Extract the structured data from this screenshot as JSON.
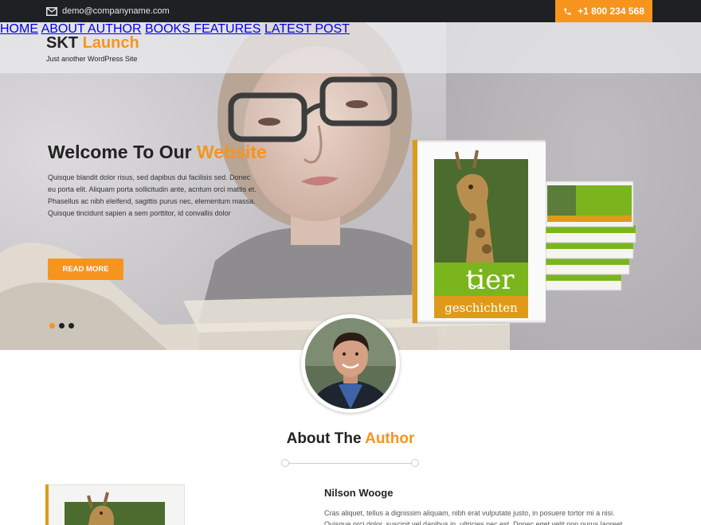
{
  "topbar": {
    "email": "demo@companyname.com",
    "phone": "+1 800 234 568"
  },
  "header": {
    "logo_main": "SKT ",
    "logo_accent": "Launch",
    "tagline": "Just another WordPress Site"
  },
  "nav": {
    "items": [
      "HOME",
      "ABOUT AUTHOR",
      "BOOKS FEATURES",
      "LATEST POST"
    ]
  },
  "hero": {
    "title_main": "Welcome To Our ",
    "title_accent": "Website",
    "text": "Quisque blandit dolor risus, sed dapibus dui facilisis sed. Donec eu porta elit. Aliquam porta sollicitudin ante, acntum orci mattis et. Phasellus ac nibh eleifend, sagittis purus nec, elementum massa. Quisque tincidunt sapien a sem porttitor, id convallis dolor",
    "button_label": "READ MORE",
    "slides": 3,
    "active_slide": 1
  },
  "book": {
    "title_line1": "tier",
    "title_line2": "geschichten"
  },
  "about": {
    "title_main": "About The ",
    "title_accent": "Author",
    "author_name": "Nilson Wooge",
    "bio": "Cras aliquet, tellus a dignissim aliquam, nibh erat vulputate justo, in posuere tortor mi a nisi. Quisque orci dolor, suscipit vel dapibus in, ultricies nec est. Donec eget velit non purus laoreet interdum in quis augue."
  },
  "colors": {
    "accent": "#f7941d",
    "topbar": "#1e2124",
    "book_green": "#7ab51d"
  }
}
